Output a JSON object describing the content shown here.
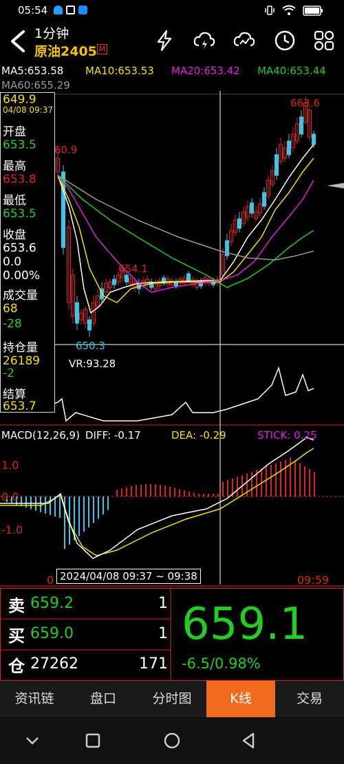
{
  "status": {
    "time": "05:54"
  },
  "header": {
    "period": "1分钟",
    "symbol": "原油2405",
    "badge": "M"
  },
  "ma": {
    "ma5": "MA5:653.58",
    "ma10": "MA10:653.53",
    "ma20": "MA20:653.42",
    "ma40": "MA40:653.44",
    "ma60": "MA60:655.29"
  },
  "infobox": {
    "price": "649.9",
    "datetime": "04/08 09:37",
    "open_label": "开盘",
    "open": "653.5",
    "high_label": "最高",
    "high": "653.8",
    "low_label": "最低",
    "low": "653.5",
    "close_label": "收盘",
    "close": "653.6",
    "change": "0.0",
    "change_pct": "0.00%",
    "volume_label": "成交量",
    "volume": "68",
    "volume_change": "-28",
    "oi_label": "持仓量",
    "oi": "26189",
    "oi_change": "-2",
    "settle_label": "结算",
    "settle": "653.7"
  },
  "annotations": {
    "high_mark": "663.6",
    "left_mark": "60.9",
    "mid_mark": "654.1",
    "low_mark": "650.3"
  },
  "vr": {
    "label": "VR:93.28"
  },
  "macd": {
    "title": "MACD(12,26,9)",
    "diff": "DIFF: -0.17",
    "dea": "DEA: -0.29",
    "stick": "STICK: 0.25",
    "y_top": "1.0",
    "y_mid": "0.0",
    "y_bot": "-1.0"
  },
  "axis": {
    "start": "0",
    "cursor_time": "2024/04/08 09:37 ~ 09:38",
    "end": "09:59"
  },
  "quote": {
    "sell_label": "卖",
    "sell_price": "659.2",
    "sell_vol": "1",
    "buy_label": "买",
    "buy_price": "659.0",
    "buy_vol": "1",
    "oi_label": "仓",
    "oi_value": "27262",
    "oi_diff": "171",
    "last_price": "659.1",
    "change": "-6.5/0.98%"
  },
  "tabs": [
    {
      "label": "资讯链",
      "active": false
    },
    {
      "label": "盘口",
      "active": false
    },
    {
      "label": "分时图",
      "active": false
    },
    {
      "label": "K线",
      "active": true
    },
    {
      "label": "交易",
      "active": false
    }
  ],
  "colors": {
    "up": "#e02020",
    "down": "#35c8e8",
    "ma5": "#ffffff",
    "ma10": "#f5e000",
    "ma20": "#e020e0",
    "ma40": "#22c822",
    "ma60": "#999999",
    "green_text": "#22cc22",
    "accent": "#f26b1d"
  }
}
